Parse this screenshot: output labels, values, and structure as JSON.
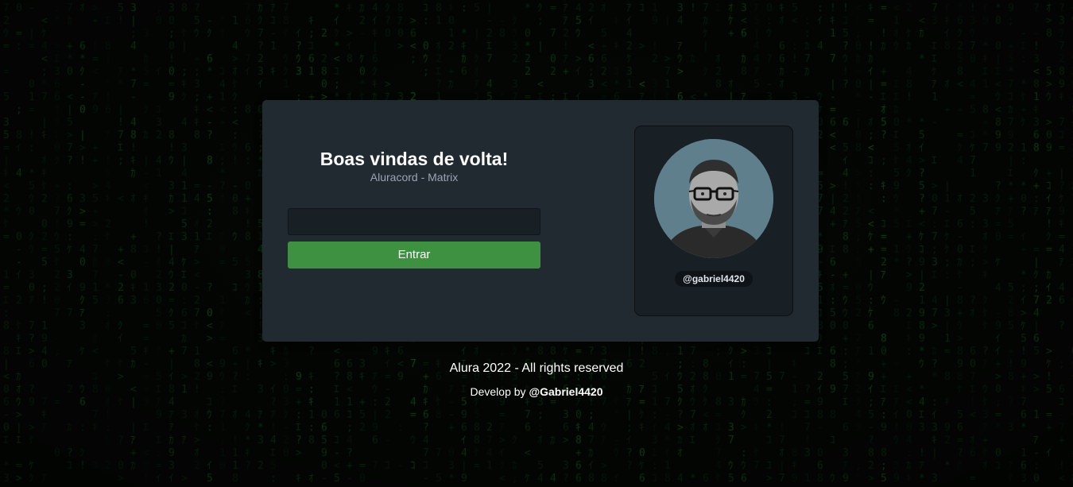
{
  "login": {
    "title": "Boas vindas de volta!",
    "subtitle": "Aluracord - Matrix",
    "username_value": "",
    "submit_label": "Entrar"
  },
  "profile": {
    "username": "@gabriel4420"
  },
  "footer": {
    "copyright": "Alura 2022 - All rights reserved",
    "credit_prefix": "Develop by",
    "author": "@Gabriel4420"
  },
  "colors": {
    "card_background": "#212931",
    "panel_background": "#181f25",
    "button_green": "#3f9142",
    "matrix_green": "#1a9c3a"
  },
  "icons": {
    "background": "matrix-rain-glyphs"
  }
}
